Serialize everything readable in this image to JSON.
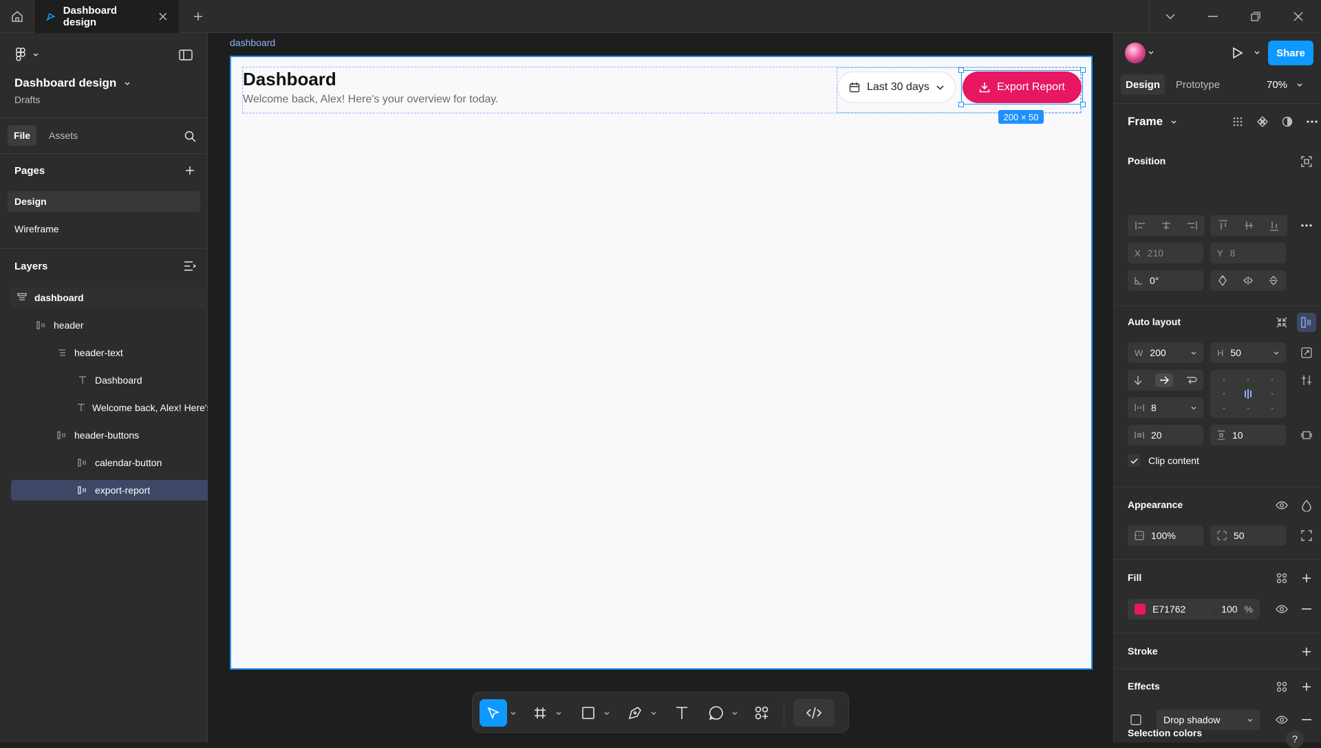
{
  "tab": {
    "title": "Dashboard design"
  },
  "file": {
    "name": "Dashboard design",
    "location": "Drafts"
  },
  "left_tabs": {
    "file": "File",
    "assets": "Assets"
  },
  "pages": {
    "title": "Pages",
    "items": [
      "Design",
      "Wireframe"
    ]
  },
  "layers": {
    "title": "Layers",
    "items": [
      {
        "name": "dashboard",
        "icon": "frame-stack-icon"
      },
      {
        "name": "header",
        "icon": "autolayout-icon"
      },
      {
        "name": "header-text",
        "icon": "stack-icon"
      },
      {
        "name": "Dashboard",
        "icon": "text-icon"
      },
      {
        "name": "Welcome back, Alex! Here's your overview for today.",
        "icon": "text-icon"
      },
      {
        "name": "header-buttons",
        "icon": "autolayout-icon"
      },
      {
        "name": "calendar-button",
        "icon": "autolayout-icon"
      },
      {
        "name": "export-report",
        "icon": "autolayout-icon"
      }
    ]
  },
  "canvas": {
    "frame_label": "dashboard",
    "heading": "Dashboard",
    "subtitle": "Welcome back, Alex! Here's your overview for today.",
    "calendar_label": "Last 30 days",
    "export_label": "Export Report",
    "size_badge": "200 × 50"
  },
  "right": {
    "share": "Share",
    "tabs": {
      "design": "Design",
      "prototype": "Prototype"
    },
    "zoom": "70%",
    "frame_title": "Frame",
    "position": {
      "title": "Position",
      "x_label": "X",
      "x": "210",
      "y_label": "Y",
      "y": "8",
      "rotation": "0°"
    },
    "auto_layout": {
      "title": "Auto layout",
      "w_label": "W",
      "w": "200",
      "h_label": "H",
      "h": "50",
      "gap": "8",
      "pad_h": "20",
      "pad_v": "10",
      "clip": "Clip content"
    },
    "appearance": {
      "title": "Appearance",
      "opacity": "100%",
      "radius": "50"
    },
    "fill": {
      "title": "Fill",
      "hex": "E71762",
      "opacity": "100",
      "unit": "%"
    },
    "stroke": {
      "title": "Stroke"
    },
    "effects": {
      "title": "Effects",
      "effect": "Drop shadow"
    },
    "selection_colors": {
      "title": "Selection colors"
    }
  },
  "colors": {
    "accent": "#0d99ff",
    "brand_pink": "#E71762",
    "selection": "#3f4766"
  }
}
